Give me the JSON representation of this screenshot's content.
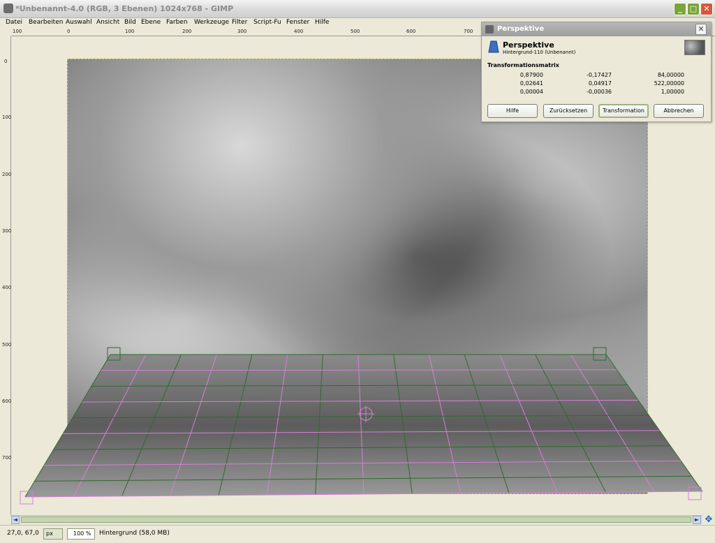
{
  "window": {
    "title": "*Unbenannt-4.0 (RGB, 3 Ebenen) 1024x768 - GIMP",
    "min_label": "_",
    "max_label": "□",
    "close_label": "✕"
  },
  "menubar": {
    "items": [
      "Datei",
      "Bearbeiten",
      "Auswahl",
      "Ansicht",
      "Bild",
      "Ebene",
      "Farben",
      "Werkzeuge",
      "Filter",
      "Script-Fu",
      "Fenster",
      "Hilfe"
    ]
  },
  "hruler": {
    "labels": [
      "100",
      "0",
      "100",
      "200",
      "300",
      "400",
      "500",
      "600",
      "700"
    ]
  },
  "vruler": {
    "labels": [
      "0",
      "100",
      "200",
      "300",
      "400",
      "500",
      "600",
      "700"
    ]
  },
  "status": {
    "coords": "27,0, 67,0",
    "unit": "px",
    "zoom": "100 %",
    "layer_info": "Hintergrund (58,0 MB)"
  },
  "scrollbar": {
    "left_arrow": "◄",
    "right_arrow": "►",
    "nav_icon": "✥"
  },
  "dialog": {
    "title": "Perspektive",
    "close_label": "✕",
    "heading": "Perspektive",
    "subheading": "Hintergrund-110 (Unbenannt)",
    "matrix_label": "Transformationsmatrix",
    "matrix": [
      [
        "0,87900",
        "-0,17427",
        "84,00000"
      ],
      [
        "0,02641",
        "0,04917",
        "522,00000"
      ],
      [
        "0,00004",
        "-0,00036",
        "1,00000"
      ]
    ],
    "buttons": {
      "help": "Hilfe",
      "reset": "Zurücksetzen",
      "transform": "Transformation",
      "cancel": "Abbrechen"
    }
  },
  "colors": {
    "grid_green": "#2d6b2d",
    "grid_pink": "#d77fd7",
    "selection_yellow": "#d6c64a"
  }
}
